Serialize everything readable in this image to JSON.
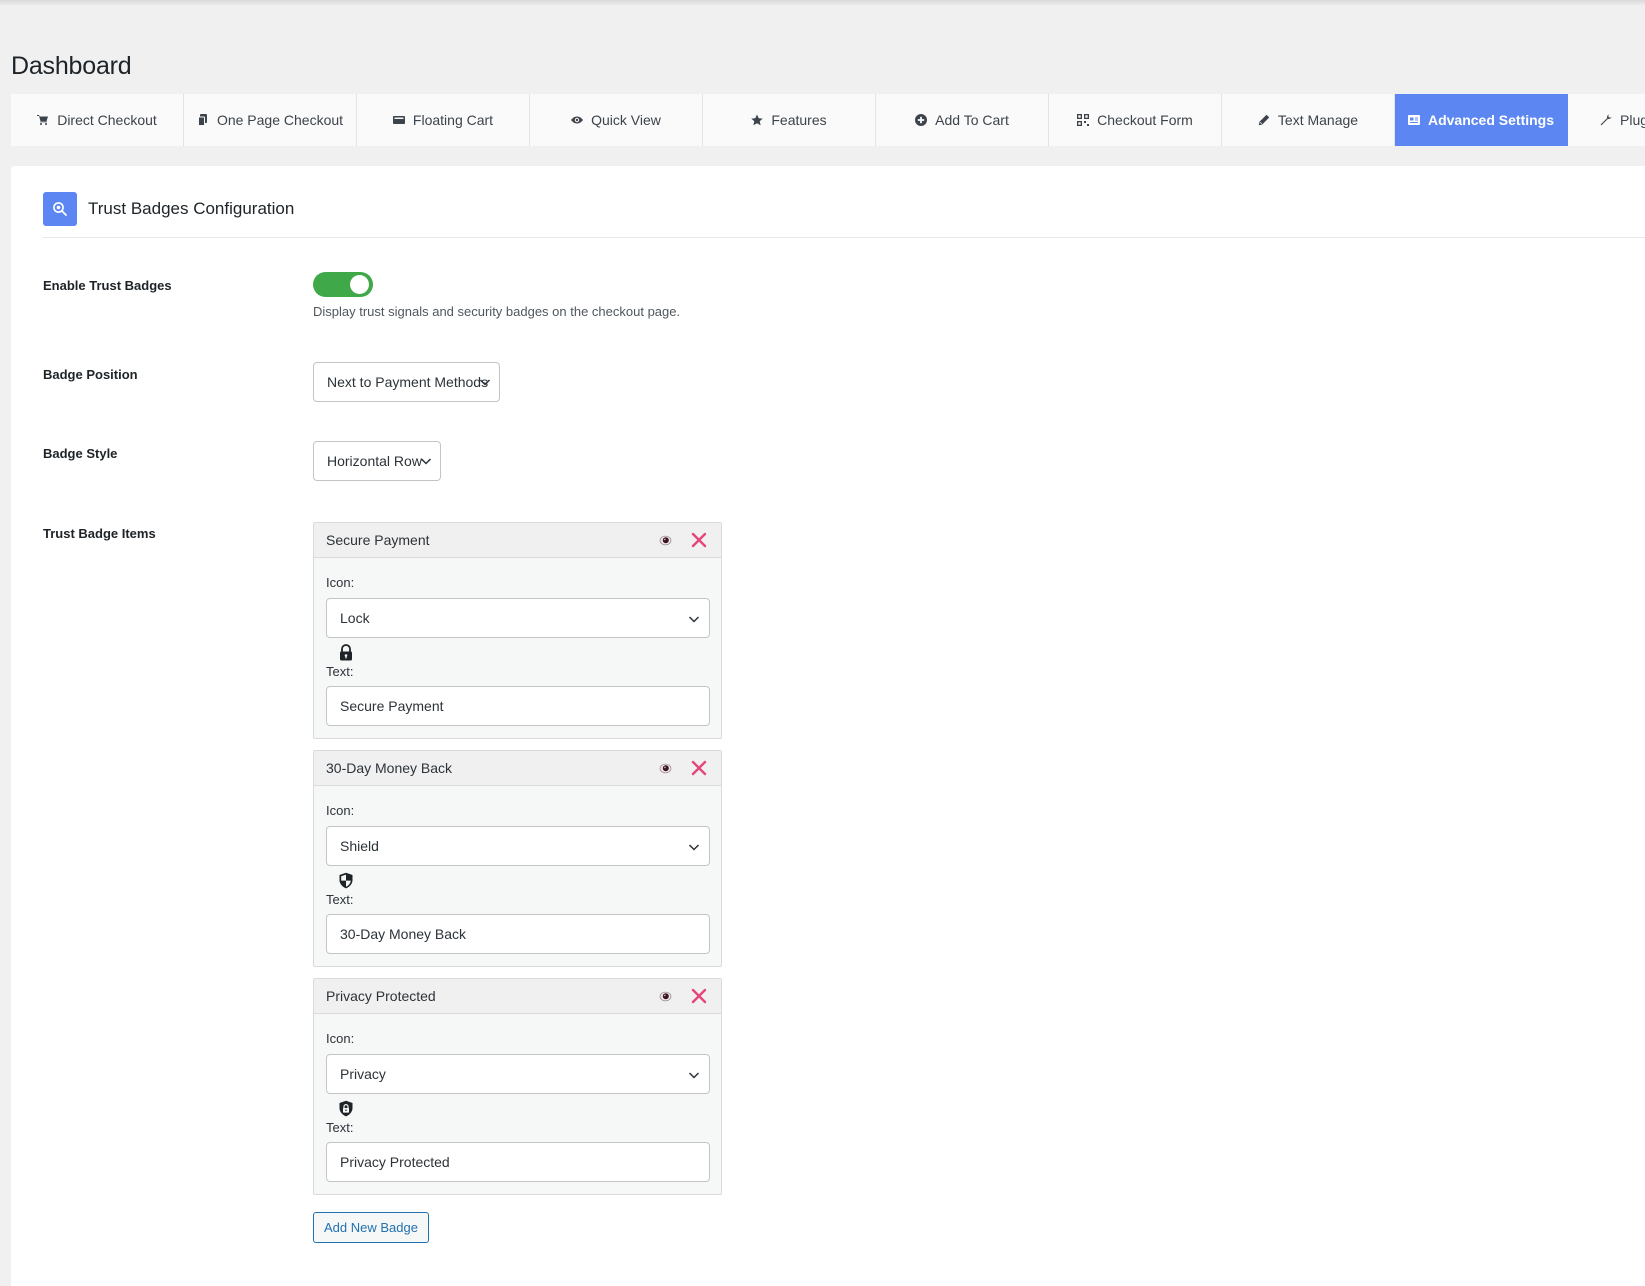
{
  "page": {
    "title": "Dashboard"
  },
  "tabs": [
    {
      "label": "Direct Checkout",
      "icon": "cart-icon"
    },
    {
      "label": "One Page Checkout",
      "icon": "pages-icon"
    },
    {
      "label": "Floating Cart",
      "icon": "floating-cart-icon"
    },
    {
      "label": "Quick View",
      "icon": "eye-icon"
    },
    {
      "label": "Features",
      "icon": "star-icon"
    },
    {
      "label": "Add To Cart",
      "icon": "plus-circle-icon"
    },
    {
      "label": "Checkout Form",
      "icon": "form-grid-icon"
    },
    {
      "label": "Text Manage",
      "icon": "pencil-icon"
    },
    {
      "label": "Advanced Settings",
      "icon": "settings-card-icon",
      "active": true
    },
    {
      "label": "Plugi",
      "icon": "wrench-icon"
    }
  ],
  "section": {
    "title": "Trust Badges Configuration",
    "icon": "badge-search-icon",
    "accent_color": "#5c87f2"
  },
  "fields": {
    "enable_label": "Enable Trust Badges",
    "enable_on": true,
    "enable_help": "Display trust signals and security badges on the checkout page.",
    "toggle_color": "#3fa848",
    "position_label": "Badge Position",
    "position_value": "Next to Payment Methods",
    "style_label": "Badge Style",
    "style_value": "Horizontal Row",
    "items_label": "Trust Badge Items"
  },
  "badges": [
    {
      "title": "Secure Payment",
      "icon_label": "Icon:",
      "icon_value": "Lock",
      "preview_icon": "lock-icon",
      "text_label": "Text:",
      "text_value": "Secure Payment"
    },
    {
      "title": "30-Day Money Back",
      "icon_label": "Icon:",
      "icon_value": "Shield",
      "preview_icon": "shield-icon",
      "text_label": "Text:",
      "text_value": "30-Day Money Back"
    },
    {
      "title": "Privacy Protected",
      "icon_label": "Icon:",
      "icon_value": "Privacy",
      "preview_icon": "privacy-shield-icon",
      "text_label": "Text:",
      "text_value": "Privacy Protected"
    }
  ],
  "actions": {
    "add_badge_label": "Add New Badge"
  },
  "colors": {
    "remove": "#e6457a",
    "link": "#2271b1"
  }
}
